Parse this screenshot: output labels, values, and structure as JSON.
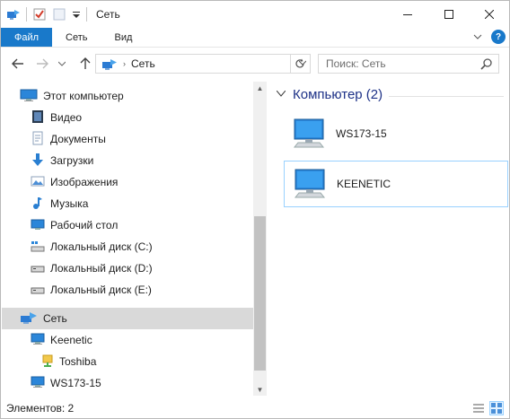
{
  "window": {
    "title": "Сеть"
  },
  "ribbon": {
    "tabs": [
      "Файл",
      "Сеть",
      "Вид"
    ],
    "help": "?"
  },
  "address": {
    "path": "Сеть"
  },
  "search": {
    "placeholder": "Поиск: Сеть"
  },
  "sidebar": {
    "items": [
      {
        "label": "Этот компьютер",
        "icon": "computer-icon"
      },
      {
        "label": "Видео",
        "icon": "video-folder-icon"
      },
      {
        "label": "Документы",
        "icon": "documents-folder-icon"
      },
      {
        "label": "Загрузки",
        "icon": "downloads-folder-icon"
      },
      {
        "label": "Изображения",
        "icon": "pictures-folder-icon"
      },
      {
        "label": "Музыка",
        "icon": "music-folder-icon"
      },
      {
        "label": "Рабочий стол",
        "icon": "desktop-folder-icon"
      },
      {
        "label": "Локальный диск (C:)",
        "icon": "system-drive-icon"
      },
      {
        "label": "Локальный диск (D:)",
        "icon": "drive-icon"
      },
      {
        "label": "Локальный диск (E:)",
        "icon": "drive-icon"
      },
      {
        "label": "Сеть",
        "icon": "network-icon",
        "selected": true
      },
      {
        "label": "Keenetic",
        "icon": "computer-icon"
      },
      {
        "label": "Toshiba",
        "icon": "share-icon"
      },
      {
        "label": "WS173-15",
        "icon": "computer-icon"
      }
    ]
  },
  "content": {
    "group": {
      "label": "Компьютер (2)"
    },
    "items": [
      {
        "name": "WS173-15",
        "icon": "computer-icon"
      },
      {
        "name": "KEENETIC",
        "icon": "computer-icon",
        "selected": true
      }
    ]
  },
  "status": {
    "count": "Элементов: 2"
  },
  "colors": {
    "accent": "#1979ca",
    "selection": "#d9d9d9",
    "group_header": "#1e3287",
    "tile_border": "#99d1ff"
  }
}
